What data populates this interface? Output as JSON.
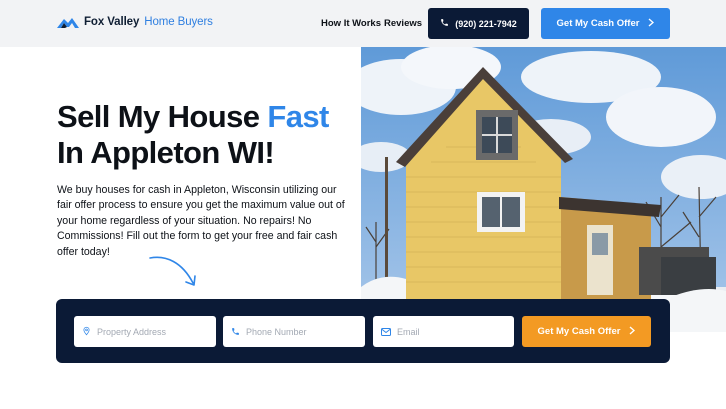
{
  "header": {
    "logo_primary": "Fox Valley",
    "logo_secondary": "Home Buyers",
    "nav": [
      {
        "label": "How It Works"
      },
      {
        "label": "Reviews"
      }
    ],
    "phone_label": "(920) 221-7942",
    "cta_label": "Get My Cash Offer"
  },
  "hero": {
    "headline_part1": "Sell My House ",
    "headline_accent": "Fast",
    "headline_line2": "In Appleton WI!",
    "paragraph": "We buy houses for cash in Appleton, Wisconsin utilizing our fair offer process to ensure you get the maximum value out of your home regardless of your situation. No repairs! No Commissions! Fill out the form to get your free and fair cash offer today!"
  },
  "form": {
    "address_placeholder": "Property Address",
    "phone_placeholder": "Phone Number",
    "email_placeholder": "Email",
    "submit_label": "Get My Cash Offer"
  },
  "colors": {
    "brand_blue": "#2f86e8",
    "navy": "#0b1a36",
    "orange": "#f39a23"
  },
  "icons": {
    "logo": "roof-logo-icon",
    "phone": "phone-icon",
    "chevron": "chevron-right-icon",
    "location": "map-pin-icon",
    "email": "envelope-icon"
  }
}
